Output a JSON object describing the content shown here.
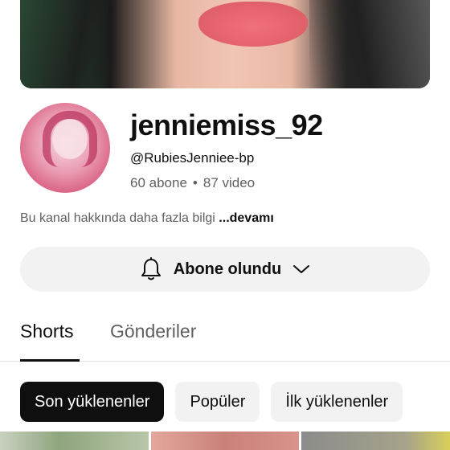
{
  "channel": {
    "name": "jenniemiss_92",
    "handle": "@RubiesJenniee-bp",
    "subscribers": "60 abone",
    "separator": "•",
    "videos": "87 video"
  },
  "about": {
    "text": "Bu kanal hakkında daha fazla bilgi",
    "more_label": "...devamı"
  },
  "subscribe_button": {
    "label": "Abone olundu",
    "bell_icon": "bell-icon",
    "chevron_icon": "chevron-down-icon"
  },
  "tabs": [
    {
      "label": "Shorts",
      "active": true
    },
    {
      "label": "Gönderiler",
      "active": false
    }
  ],
  "filters": [
    {
      "label": "Son yüklenenler",
      "selected": true
    },
    {
      "label": "Popüler",
      "selected": false
    },
    {
      "label": "İlk yüklenenler",
      "selected": false
    }
  ],
  "colors": {
    "text_primary": "#0f0f0f",
    "text_secondary": "#606060",
    "chip_bg": "#f2f2f2",
    "chip_selected_bg": "#0f0f0f"
  }
}
